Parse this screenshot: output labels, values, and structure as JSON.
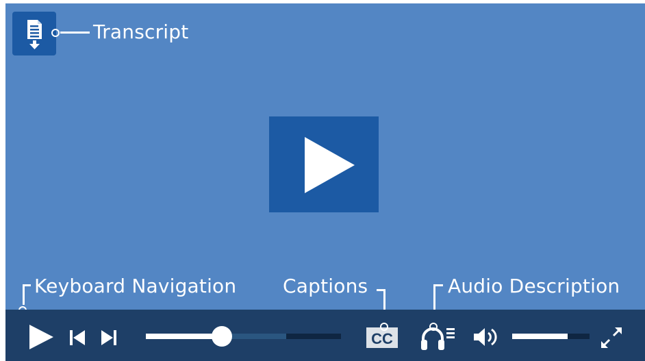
{
  "annotations": {
    "transcript": "Transcript",
    "keyboard_navigation": "Keyboard Navigation",
    "captions": "Captions",
    "audio_description": "Audio Description"
  },
  "player": {
    "background_color": "#5386c4",
    "button_color": "#1c5aa4",
    "control_bar_color": "#1e3f67"
  },
  "controls": {
    "transcript_icon": "transcript-download-icon",
    "big_play_icon": "play-icon",
    "play_icon": "play-icon",
    "previous_icon": "skip-previous-icon",
    "next_icon": "skip-next-icon",
    "captions_icon": "closed-captions-icon",
    "captions_label": "CC",
    "audio_description_icon": "headphones-audio-description-icon",
    "volume_icon": "speaker-volume-icon",
    "fullscreen_icon": "fullscreen-expand-icon"
  },
  "progress": {
    "played_fraction": 0.39,
    "buffered_fraction": 0.72
  },
  "volume": {
    "level_fraction": 0.72
  }
}
